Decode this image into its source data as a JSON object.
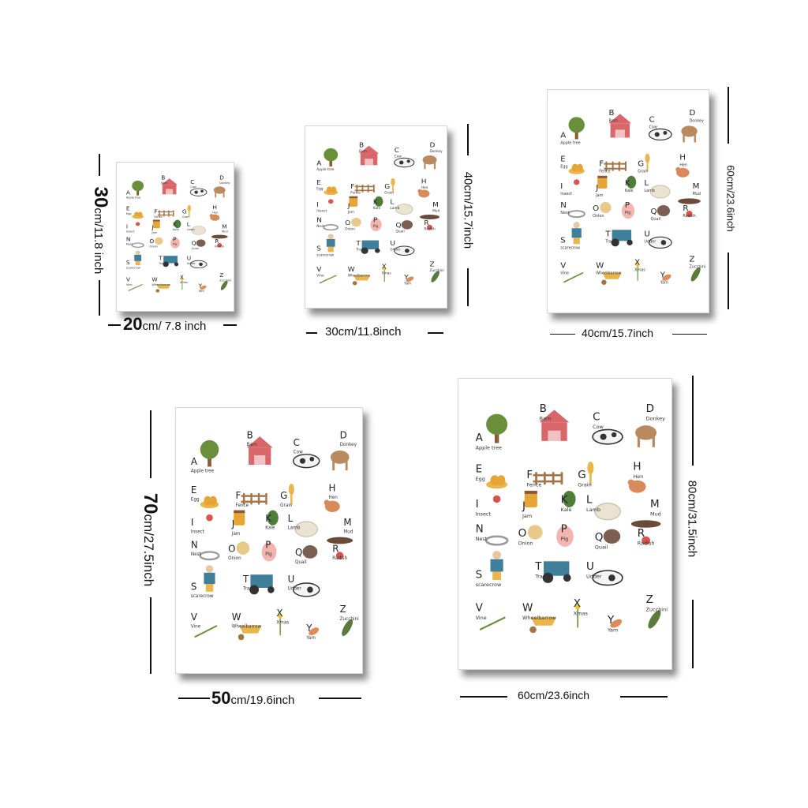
{
  "posters": [
    {
      "id": "p20",
      "width_label_big": "20",
      "width_label_unit": "cm/ 7.8 inch",
      "height_label_big": "30",
      "height_label_unit": "cm/11.8 inch"
    },
    {
      "id": "p30",
      "width_label": "30cm/11.8inch",
      "height_label": "40cm/15.7inch"
    },
    {
      "id": "p40",
      "width_label": "40cm/15.7inch",
      "height_label": "60cm/23.6inch"
    },
    {
      "id": "p50",
      "width_label_big": "50",
      "width_label_unit": "cm/19.6inch",
      "height_label_big": "70",
      "height_label_unit": "cm/27.5inch"
    },
    {
      "id": "p60",
      "width_label": "60cm/23.6inch",
      "height_label": "80cm/31.5inch"
    }
  ],
  "alphabet": [
    {
      "letter": "A",
      "word": "Apple tree"
    },
    {
      "letter": "B",
      "word": "Barn"
    },
    {
      "letter": "C",
      "word": "Cow"
    },
    {
      "letter": "D",
      "word": "Donkey"
    },
    {
      "letter": "E",
      "word": "Egg"
    },
    {
      "letter": "F",
      "word": "Fence"
    },
    {
      "letter": "G",
      "word": "Grain"
    },
    {
      "letter": "H",
      "word": "Hen"
    },
    {
      "letter": "I",
      "word": "Insect"
    },
    {
      "letter": "J",
      "word": "Jam"
    },
    {
      "letter": "K",
      "word": "Kale"
    },
    {
      "letter": "L",
      "word": "Lamb"
    },
    {
      "letter": "M",
      "word": "Mud"
    },
    {
      "letter": "N",
      "word": "Nest"
    },
    {
      "letter": "O",
      "word": "Onion"
    },
    {
      "letter": "P",
      "word": "Pig"
    },
    {
      "letter": "Q",
      "word": "Quail"
    },
    {
      "letter": "R",
      "word": "Radish"
    },
    {
      "letter": "S",
      "word": "scarecrow"
    },
    {
      "letter": "T",
      "word": "Tractor"
    },
    {
      "letter": "U",
      "word": "Udder"
    },
    {
      "letter": "V",
      "word": "Vine"
    },
    {
      "letter": "W",
      "word": "Wheelbarrow"
    },
    {
      "letter": "X",
      "word": "Xmas"
    },
    {
      "letter": "Y",
      "word": "Yam"
    },
    {
      "letter": "Z",
      "word": "Zucchini"
    }
  ],
  "colors": {
    "barn": "#d9676a",
    "tree": "#6a8f3a",
    "trunk": "#8a5a32",
    "tractor": "#3f7f9a",
    "pig": "#f2b5b0",
    "egg": "#e6a536",
    "hay": "#e8b64a",
    "fence": "#a27548",
    "kale": "#4f7d3a",
    "zucchini": "#5b7a3c",
    "radish": "#d9534f",
    "yam": "#e08a5a",
    "onion": "#e8c98a",
    "mud": "#6b4a3a",
    "cow": "#333333",
    "donkey": "#b98a60",
    "hen": "#d98a5a",
    "lamb": "#eae3d2"
  }
}
